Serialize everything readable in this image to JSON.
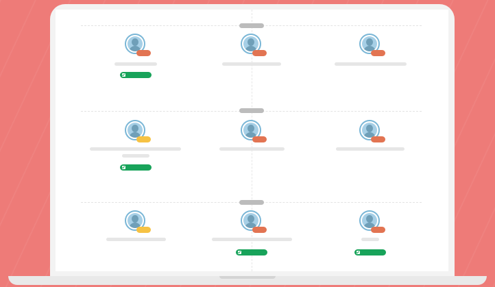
{
  "colors": {
    "background": "#ee7b78",
    "laptop_frame": "#f3f3f3",
    "screen": "#ffffff",
    "badge_orange": "#e27452",
    "badge_yellow": "#f6c243",
    "check_green": "#18a35a",
    "avatar_ring": "#79b6d6"
  },
  "icons": {
    "avatar": "user-avatar-icon",
    "check": "checkbox-checked-icon"
  },
  "rows": [
    {
      "cards": [
        {
          "badge": "orange",
          "checked": true
        },
        {
          "badge": "orange",
          "checked": false
        },
        {
          "badge": "orange",
          "checked": false
        }
      ]
    },
    {
      "cards": [
        {
          "badge": "yellow",
          "checked": true
        },
        {
          "badge": "orange",
          "checked": false
        },
        {
          "badge": "orange",
          "checked": false
        }
      ]
    },
    {
      "cards": [
        {
          "badge": "yellow",
          "checked": false
        },
        {
          "badge": "orange",
          "checked": true
        },
        {
          "badge": "orange",
          "checked": true
        }
      ]
    }
  ]
}
